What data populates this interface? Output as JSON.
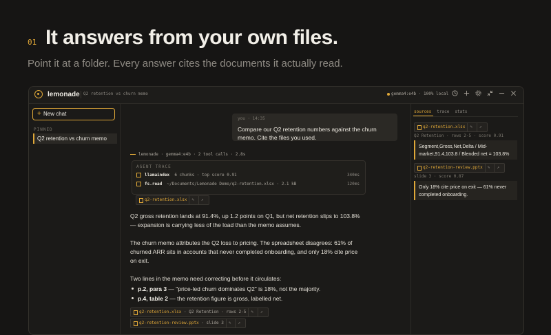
{
  "hero": {
    "number": "01",
    "title": "It answers from your own files.",
    "subtitle": "Point it at a folder. Every answer cites the documents it actually read."
  },
  "window": {
    "app_name": "lemonade",
    "chat_title": "Q2 retention vs churn memo",
    "model": "gemma4:e4b",
    "locality": "100% local",
    "icons": [
      "history-icon",
      "plus-icon",
      "gear-icon",
      "collapse-icon",
      "minimize-icon",
      "close-icon"
    ]
  },
  "sidebar": {
    "new_chat": "New chat",
    "pinned_label": "PINNED",
    "pinned_items": [
      "Q2 retention vs churn memo"
    ]
  },
  "user_message": {
    "meta": "you · 14:35",
    "text": "Compare our Q2 retention numbers against the churn memo. Cite the files you used."
  },
  "assistant": {
    "meta": "lemonade · gemma4:e4b · 2 tool calls · 2.8s",
    "trace_label": "AGENT TRACE",
    "trace": [
      {
        "tool": "llamaindex",
        "detail": "6 chunks · top score 0.91",
        "ms": "340ms"
      },
      {
        "tool": "fs.read",
        "detail": "~/Documents/Lemonade Demo/q2-retention.xlsx · 2.1 kB",
        "ms": "120ms"
      }
    ],
    "trace_chip": "q2-retention.xlsx",
    "paragraphs": [
      "Q2 gross retention lands at 91.4%, up 1.2 points on Q1, but net retention slips to 103.8% — expansion is carrying less of the load than the memo assumes.",
      "The churn memo attributes the Q2 loss to pricing. The spreadsheet disagrees: 61% of churned ARR sits in accounts that never completed onboarding, and only 18% cite price on exit.",
      "Two lines in the memo need correcting before it circulates:"
    ],
    "bullets": [
      {
        "bold": "p.2, para 3",
        "rest": " — \"price-led churn dominates Q2\" is 18%, not the majority."
      },
      {
        "bold": "p.4, table 2",
        "rest": " — the retention figure is gross, labelled net."
      }
    ],
    "citations": [
      {
        "file": "q2-retention.xlsx",
        "detail": "Q2 Retention · rows 2-5"
      },
      {
        "file": "q2-retention-review.pptx",
        "detail": "slide 3"
      }
    ],
    "chip_actions": [
      "✎",
      "↗"
    ]
  },
  "sources_panel": {
    "tabs": [
      "sources",
      "trace",
      "stats"
    ],
    "items": [
      {
        "file": "q2-retention.xlsx",
        "meta": "Q2 Retention · rows 2-5 · score 0.91",
        "quote": "Segment,Gross,Net,Delta / Mid-market,91.4,103.8 / Blended net = 103.8%"
      },
      {
        "file": "q2-retention-review.pptx",
        "meta": "slide 3 · score 0.87",
        "quote": "Only 18% cite price on exit — 61% never completed onboarding."
      }
    ]
  },
  "colors": {
    "accent": "#e0a838",
    "background": "#161514",
    "panel": "#1b1a18"
  }
}
